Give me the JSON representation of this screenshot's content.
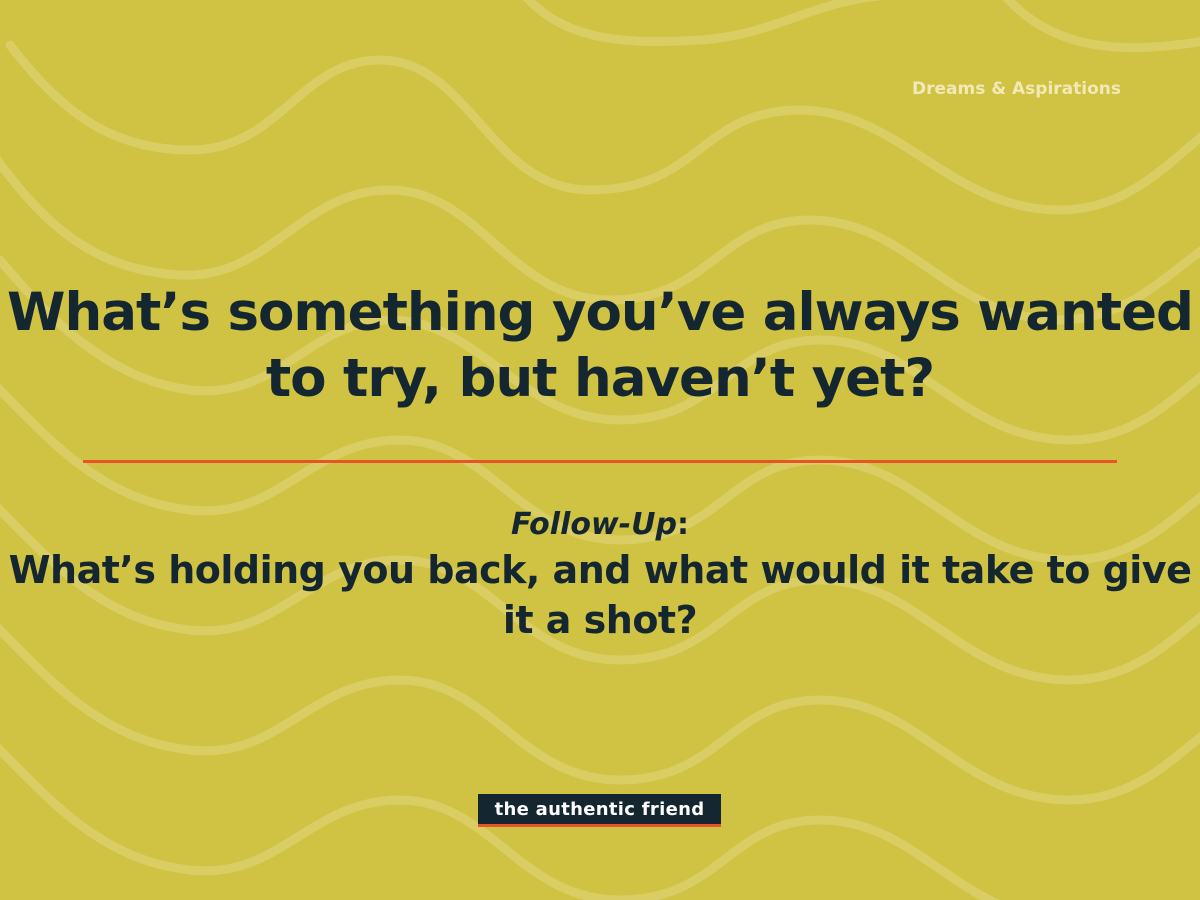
{
  "category": "Dreams & Aspirations",
  "question": "What’s something you’ve always wanted to try, but haven’t yet?",
  "followup": {
    "label": "Follow-Up",
    "colon": ":",
    "text": "What’s holding you back, and what would it take to give it a shot?"
  },
  "logo": {
    "text": "the authentic friend"
  },
  "colors": {
    "background": "#d0c242",
    "text": "#14262f",
    "accent": "#e8542a",
    "category_text": "#f1eab8"
  }
}
